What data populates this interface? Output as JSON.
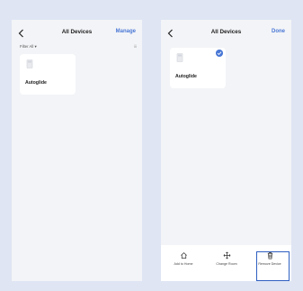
{
  "left_screen": {
    "title": "All Devices",
    "action_label": "Manage",
    "filter_label": "Filter All",
    "filter_caret": "▾",
    "count_icon": "iii",
    "device": {
      "name": "Autoglide",
      "icon": "device-icon"
    }
  },
  "right_screen": {
    "title": "All Devices",
    "action_label": "Done",
    "device": {
      "name": "Autoglide",
      "icon": "device-icon",
      "selected": true
    },
    "toolbar": {
      "add_label": "Add to Home",
      "change_label": "Change Room",
      "remove_label": "Remove Device"
    }
  },
  "colors": {
    "background": "#dfe5f3",
    "screen": "#f3f4f7",
    "accent": "#4a78d6",
    "highlight": "#2f5fc2"
  }
}
